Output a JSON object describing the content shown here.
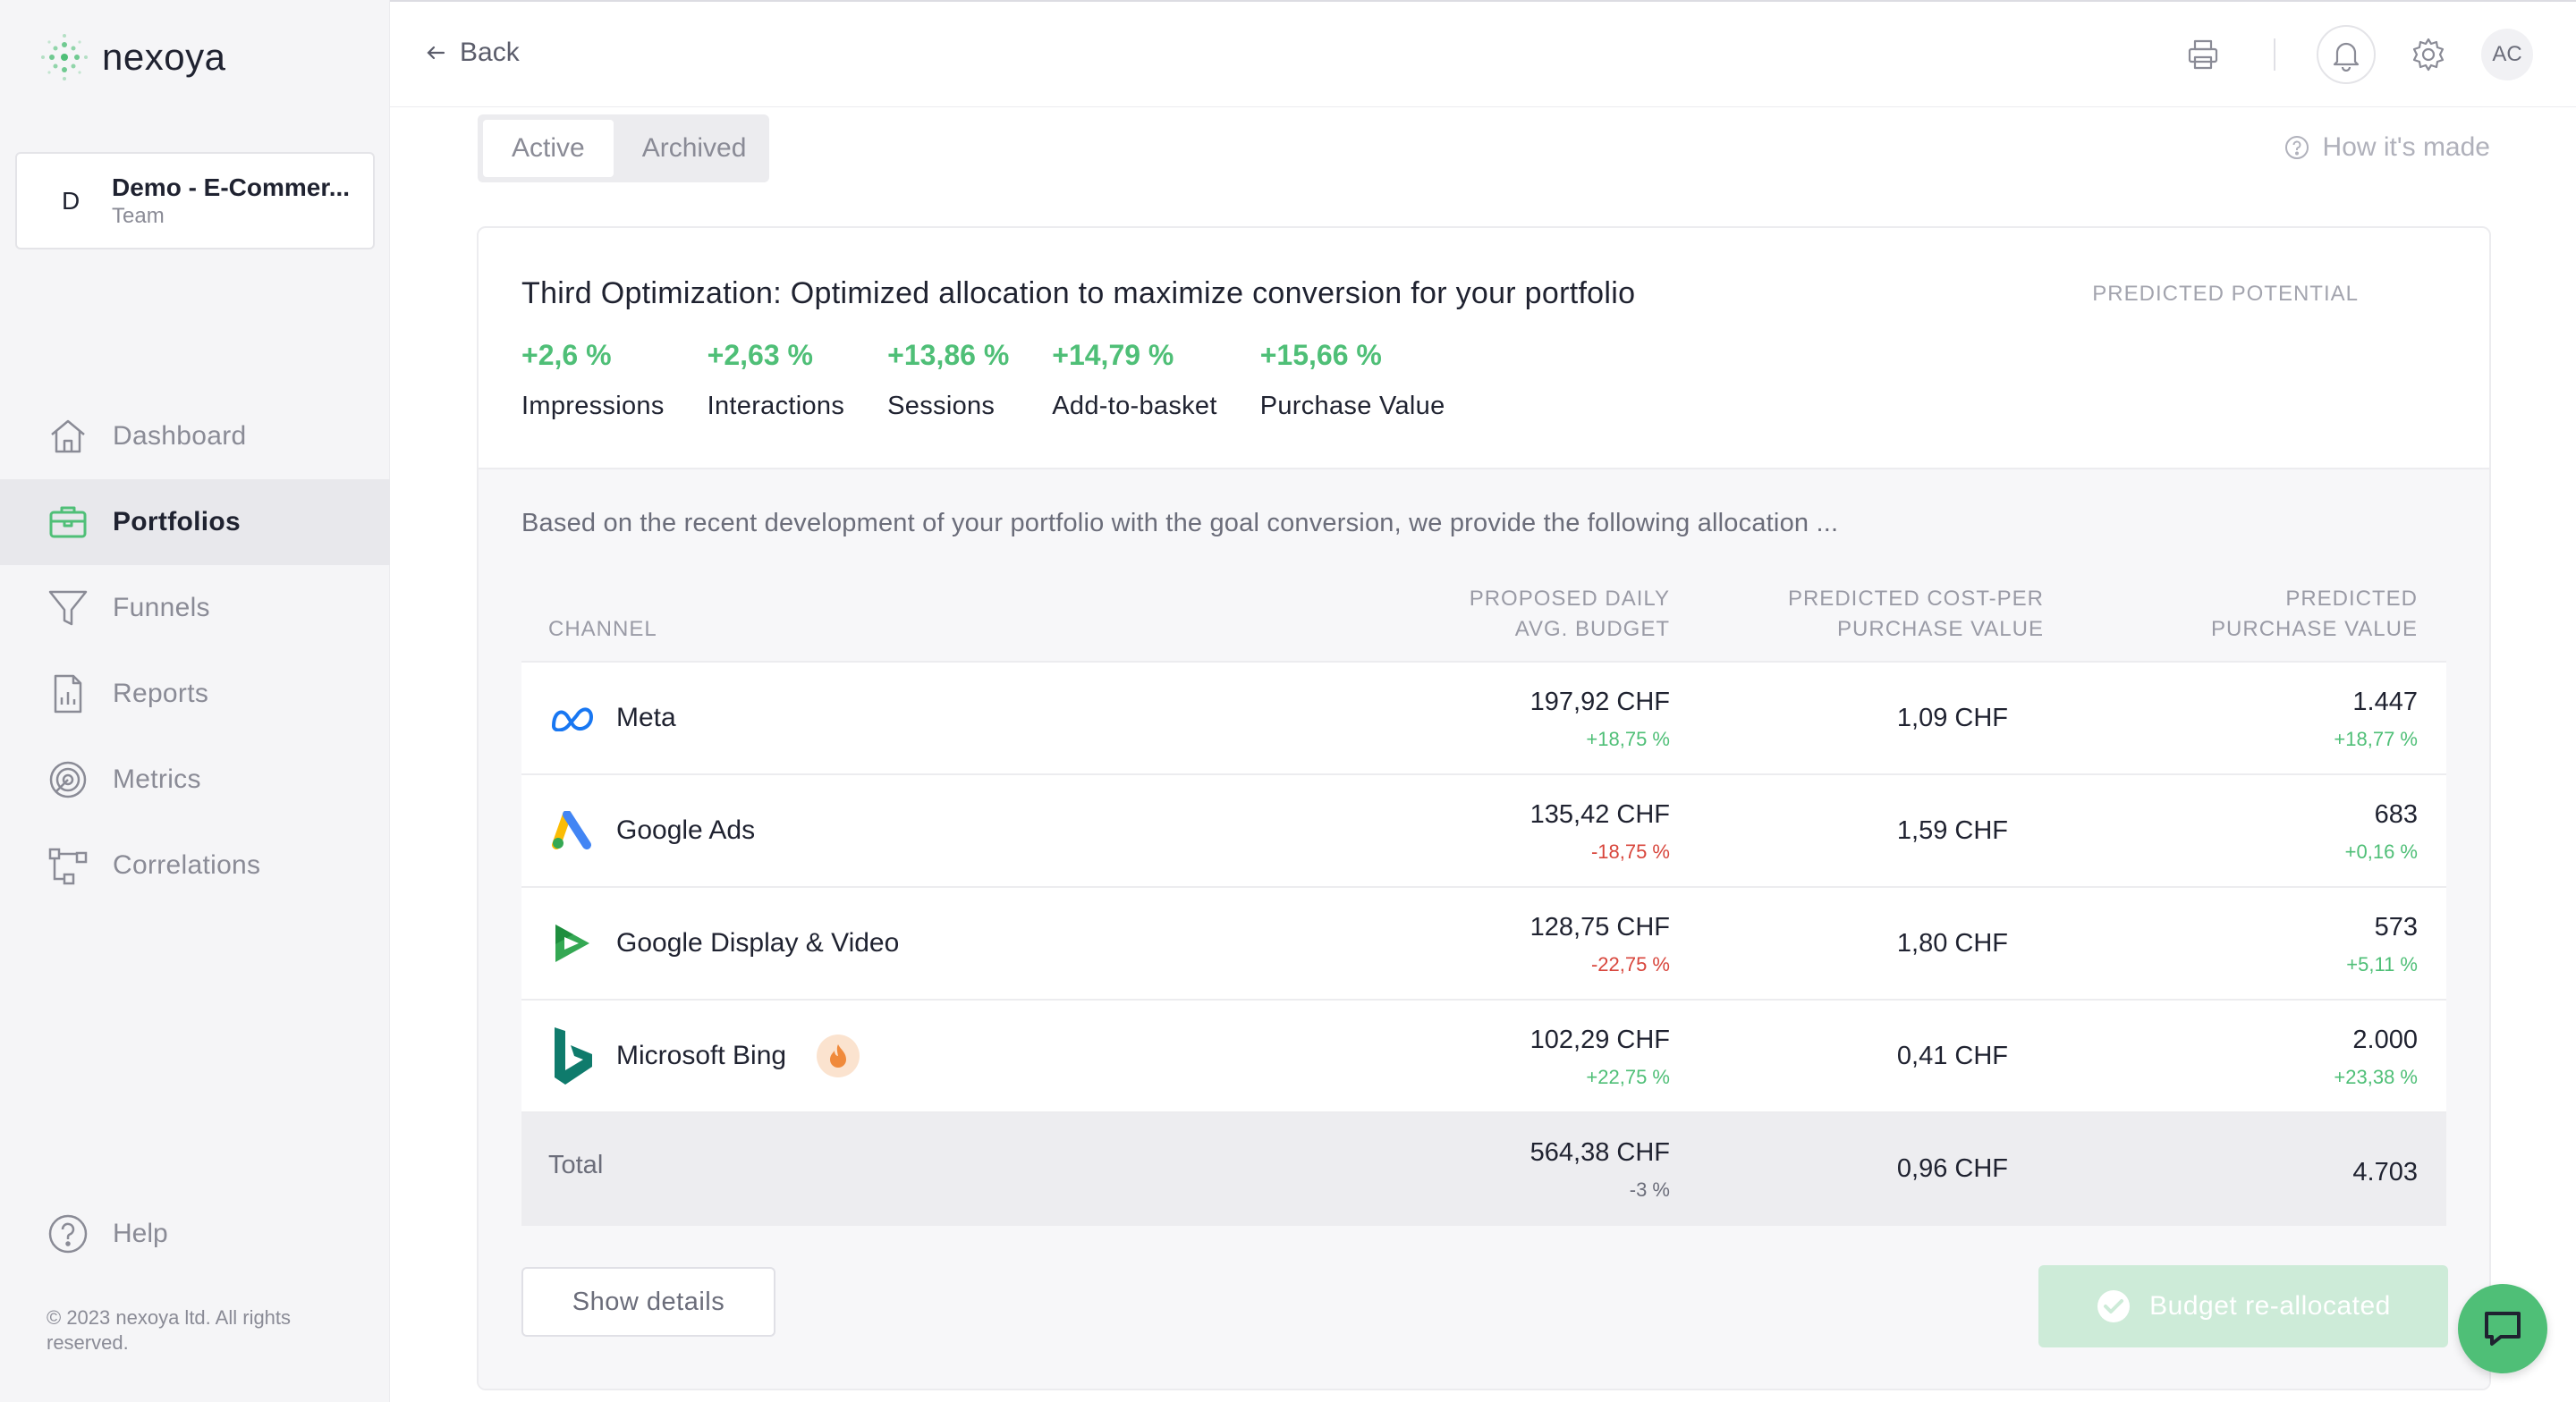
{
  "brand": {
    "name": "nexoya"
  },
  "workspace": {
    "initial": "D",
    "name": "Demo - E-Commer...",
    "type": "Team"
  },
  "nav": {
    "items": [
      {
        "label": "Dashboard",
        "icon": "home-icon"
      },
      {
        "label": "Portfolios",
        "icon": "briefcase-icon",
        "active": true
      },
      {
        "label": "Funnels",
        "icon": "funnel-icon"
      },
      {
        "label": "Reports",
        "icon": "report-icon"
      },
      {
        "label": "Metrics",
        "icon": "target-icon"
      },
      {
        "label": "Correlations",
        "icon": "network-icon"
      }
    ],
    "help": "Help",
    "copyright": "© 2023 nexoya ltd. All rights reserved."
  },
  "header": {
    "back_label": "Back",
    "avatar_initials": "AC"
  },
  "tabs": {
    "active": "Active",
    "archived": "Archived"
  },
  "how_its_made": "How it's made",
  "card": {
    "title": "Third Optimization: Optimized allocation to maximize conversion for your portfolio",
    "predicted_potential": "PREDICTED POTENTIAL",
    "metrics": [
      {
        "value": "+2,6 %",
        "label": "Impressions"
      },
      {
        "value": "+2,63 %",
        "label": "Interactions"
      },
      {
        "value": "+13,86 %",
        "label": "Sessions"
      },
      {
        "value": "+14,79 %",
        "label": "Add-to-basket"
      },
      {
        "value": "+15,66 %",
        "label": "Purchase Value"
      }
    ],
    "description": "Based on the recent development of your portfolio with the goal conversion, we provide the following allocation ...",
    "table": {
      "headers": {
        "channel": "CHANNEL",
        "budget_line1": "PROPOSED DAILY",
        "budget_line2": "AVG. BUDGET",
        "cpp_line1": "PREDICTED COST-PER",
        "cpp_line2": "PURCHASE VALUE",
        "pv_line1": "PREDICTED",
        "pv_line2": "PURCHASE VALUE"
      },
      "rows": [
        {
          "channel": "Meta",
          "budget": "197,92 CHF",
          "budget_delta": "+18,75 %",
          "cpp": "1,09 CHF",
          "pv": "1.447",
          "pv_delta": "+18,77 %"
        },
        {
          "channel": "Google Ads",
          "budget": "135,42 CHF",
          "budget_delta": "-18,75 %",
          "cpp": "1,59 CHF",
          "pv": "683",
          "pv_delta": "+0,16 %"
        },
        {
          "channel": "Google Display & Video",
          "budget": "128,75 CHF",
          "budget_delta": "-22,75 %",
          "cpp": "1,80 CHF",
          "pv": "573",
          "pv_delta": "+5,11 %"
        },
        {
          "channel": "Microsoft Bing",
          "budget": "102,29 CHF",
          "budget_delta": "+22,75 %",
          "cpp": "0,41 CHF",
          "pv": "2.000",
          "pv_delta": "+23,38 %"
        }
      ],
      "total": {
        "label": "Total",
        "budget": "564,38 CHF",
        "budget_delta": "-3 %",
        "cpp": "0,96 CHF",
        "pv": "4.703"
      }
    },
    "show_details": "Show details",
    "reallocated": "Budget re-allocated"
  },
  "colors": {
    "positive": "#4fbf77",
    "negative": "#d8463c",
    "accent": "#4fbf77"
  }
}
